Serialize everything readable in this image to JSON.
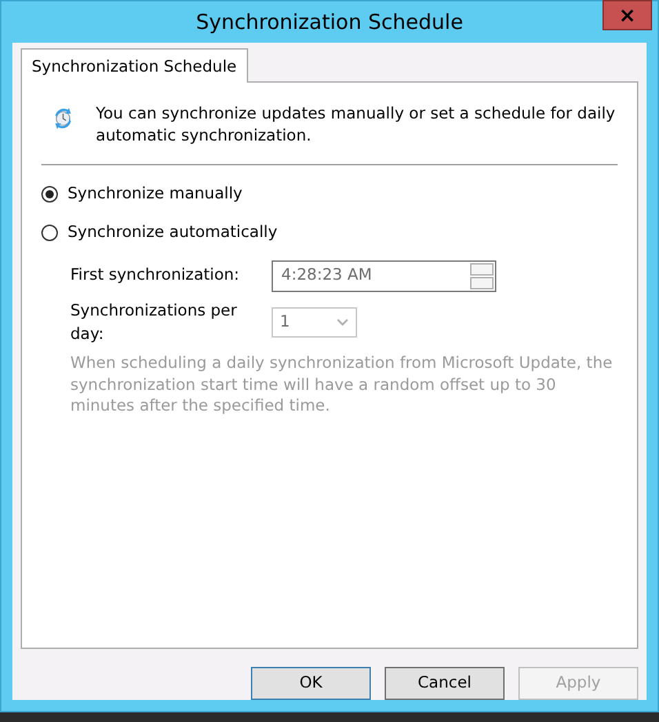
{
  "window": {
    "title": "Synchronization Schedule",
    "close": "×"
  },
  "tabs": [
    {
      "label": "Synchronization Schedule",
      "selected": true
    }
  ],
  "intro": "You can synchronize updates manually or set a schedule for daily automatic synchronization.",
  "options": [
    {
      "label": "Synchronize manually",
      "selected": true
    },
    {
      "label": "Synchronize automatically",
      "selected": false
    }
  ],
  "first_sync": {
    "label": "First synchronization:",
    "value": "4:28:23 AM",
    "disabled": true
  },
  "per_day": {
    "label": "Synchronizations per day:",
    "value": "1",
    "disabled": true
  },
  "note": "When scheduling a daily synchronization from Microsoft Update, the synchronization start time will have a random offset up to 30 minutes after the specified time.",
  "buttons": [
    {
      "label": "OK",
      "disabled": false,
      "default": true
    },
    {
      "label": "Cancel",
      "disabled": false,
      "default": false
    },
    {
      "label": "Apply",
      "disabled": true,
      "default": false
    }
  ]
}
